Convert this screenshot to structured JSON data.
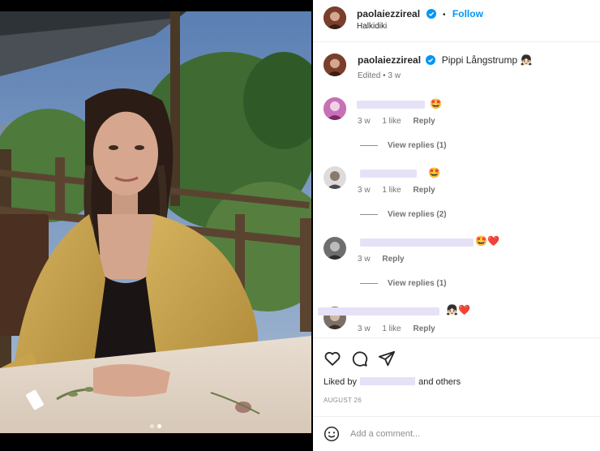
{
  "post": {
    "username": "paolaiezzireal",
    "follow_label": "Follow",
    "separator": "•",
    "location": "Halkidiki",
    "carousel": {
      "count": 2,
      "active_index": 1
    }
  },
  "caption": {
    "username": "paolaiezzireal",
    "text": "Pippi Långstrump",
    "emoji": "👧🏻",
    "edited_label": "Edited",
    "time": "3 w"
  },
  "comments": [
    {
      "emoji": "🤩",
      "time": "3 w",
      "likes": "1 like",
      "reply_label": "Reply",
      "view_replies": "View replies (1)"
    },
    {
      "emoji": "🤩",
      "time": "3 w",
      "likes": "1 like",
      "reply_label": "Reply",
      "view_replies": "View replies (2)"
    },
    {
      "emoji": "🤩❤️",
      "time": "3 w",
      "likes": "",
      "reply_label": "Reply",
      "view_replies": "View replies (1)"
    },
    {
      "emoji": "👧🏻❤️",
      "time": "3 w",
      "likes": "1 like",
      "reply_label": "Reply",
      "view_replies": ""
    }
  ],
  "footer": {
    "liked_by_prefix": "Liked by",
    "liked_by_suffix": "and others",
    "date": "AUGUST 26",
    "add_comment_placeholder": "Add a comment..."
  },
  "icons": {
    "like": "heart-icon",
    "comment": "comment-icon",
    "share": "paper-plane-icon",
    "verified": "verified-badge-icon",
    "emoji": "smiley-icon"
  },
  "colors": {
    "follow": "#0095f6",
    "verified": "#0095f6",
    "redacted": "#e6e1f7"
  }
}
